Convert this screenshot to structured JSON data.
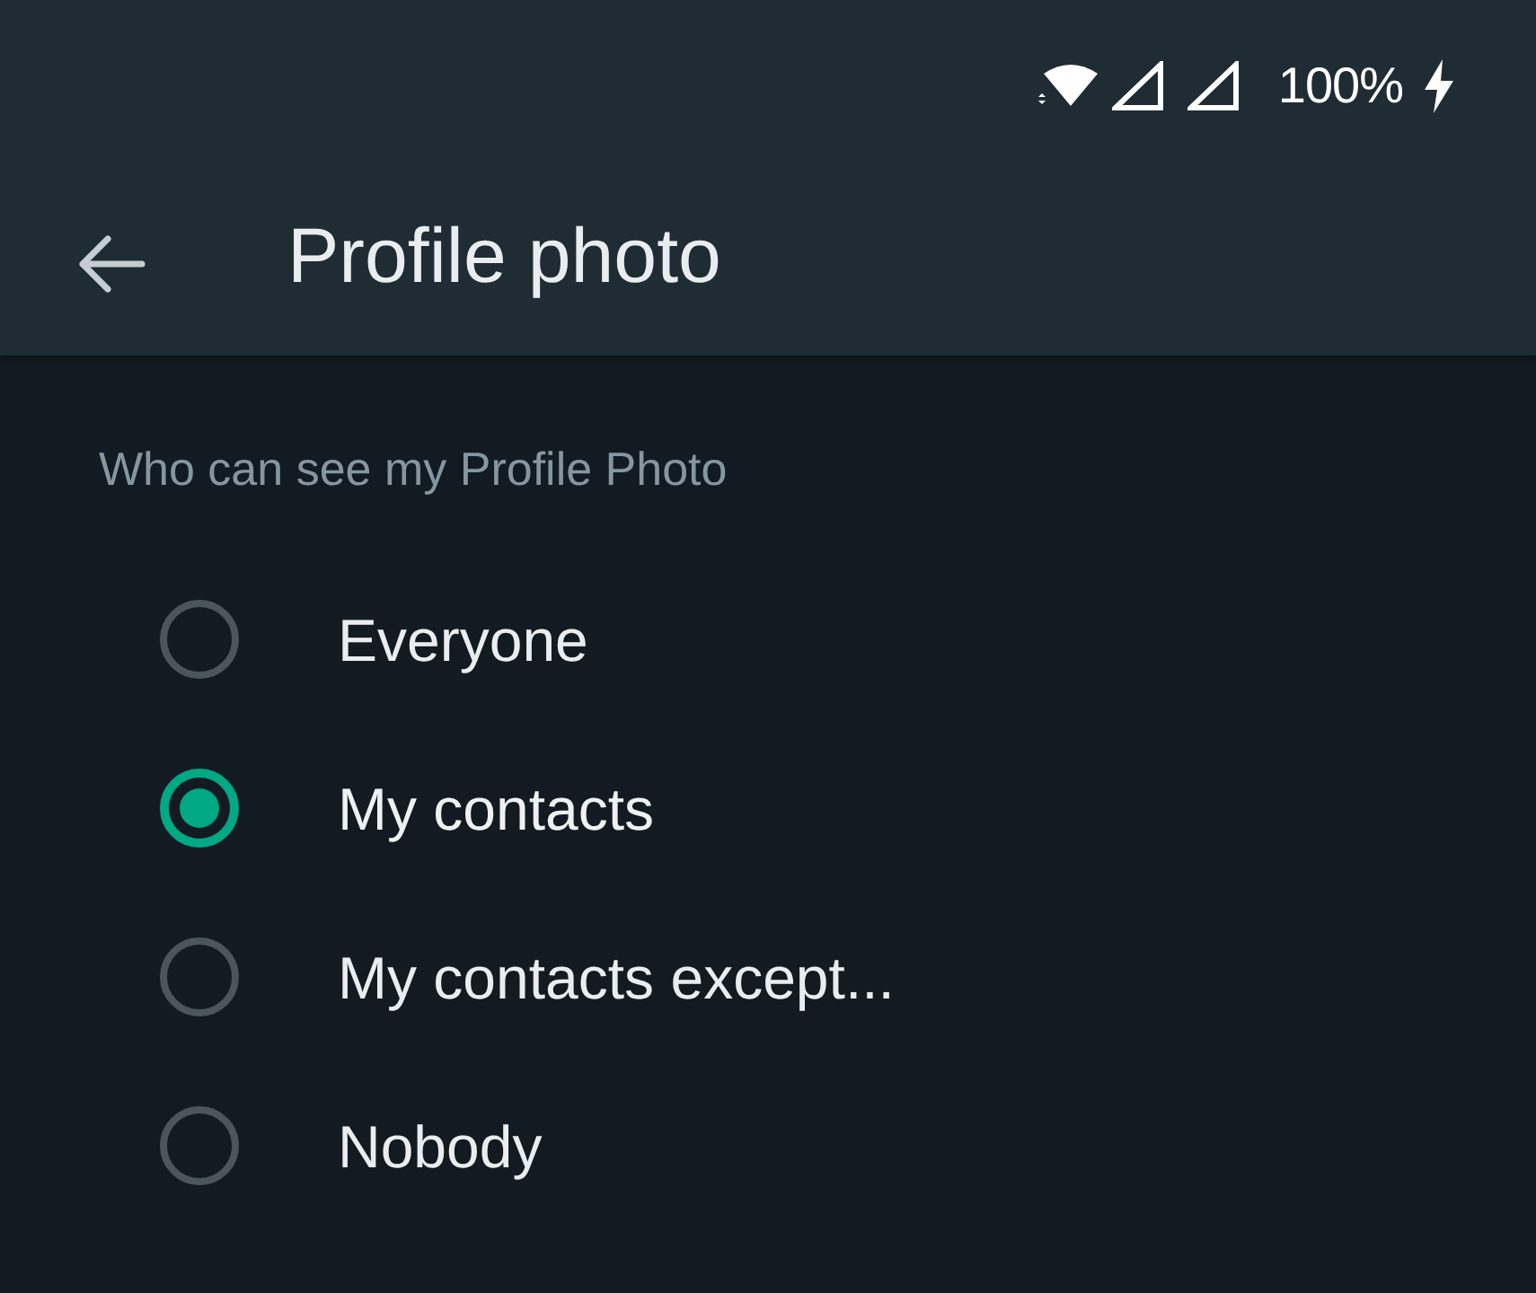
{
  "status_bar": {
    "battery": "100%"
  },
  "app_bar": {
    "title": "Profile photo"
  },
  "section": {
    "heading": "Who can see my Profile Photo"
  },
  "options": [
    {
      "label": "Everyone",
      "selected": false
    },
    {
      "label": "My contacts",
      "selected": true
    },
    {
      "label": "My contacts except...",
      "selected": false
    },
    {
      "label": "Nobody",
      "selected": false
    }
  ]
}
